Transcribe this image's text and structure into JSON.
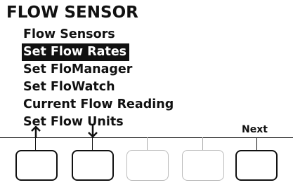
{
  "screen": {
    "title": "FLOW SENSOR",
    "menu": [
      {
        "label": "Flow Sensors",
        "selected": false
      },
      {
        "label": "Set Flow Rates",
        "selected": true
      },
      {
        "label": "Set FloManager",
        "selected": false
      },
      {
        "label": "Set FloWatch",
        "selected": false
      },
      {
        "label": "Current Flow Reading",
        "selected": false
      },
      {
        "label": "Set Flow Units",
        "selected": false
      }
    ]
  },
  "softkeys": {
    "key1_icon": "up-arrow-icon",
    "key2_icon": "down-arrow-icon",
    "key5_label": "Next"
  }
}
